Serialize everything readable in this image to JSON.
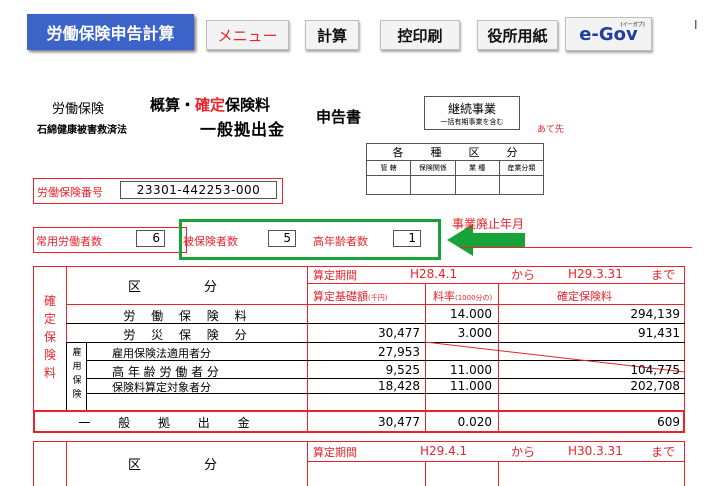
{
  "toolbar": {
    "title": "労働保険申告計算",
    "menu": "メニュー",
    "calc": "計算",
    "print": "控印刷",
    "office_form": "役所用紙",
    "egov_logo": "e-Gov",
    "egov_tag": "(イーガブ)",
    "cursor": "I"
  },
  "header": {
    "line1_a": "労働保険",
    "line1_b": "概算・",
    "line1_c": "確定",
    "line1_d": "保険料",
    "line2_a": "石綿健康被害救済法",
    "line2_b": "一般拠出金",
    "form_title": "申告書",
    "business_box_1": "継続事業",
    "business_box_2": "一括有期事業を含む",
    "addressee": "あて先"
  },
  "category_box": {
    "title_chars": [
      "各",
      "種",
      "区",
      "分"
    ],
    "cols": [
      "管 轄",
      "保険関係",
      "業 種",
      "産業分類"
    ]
  },
  "insurance_no": {
    "label": "労働保険番号",
    "value": "23301-442253-000"
  },
  "counts": {
    "regular_label": "常用労働者数",
    "regular_value": "6",
    "insured_label": "被保険者数",
    "insured_value": "5",
    "elderly_label": "高年齢者数",
    "elderly_value": "1"
  },
  "closure_label": "事業廃止年月",
  "table1": {
    "kubun": "区",
    "bun": "分",
    "period_label": "算定期間",
    "period_from": "H28.4.1",
    "from_word": "から",
    "period_to": "H29.3.31",
    "to_word": "まで",
    "base_label": "算定基礎額",
    "base_unit": "(千円)",
    "rate_label": "料率",
    "rate_unit": "(1000分の)",
    "premium_label": "確定保険料",
    "side_label": [
      "確",
      "定",
      "保",
      "険",
      "料"
    ],
    "employment_side": [
      "雇",
      "用",
      "保",
      "険"
    ],
    "rows": [
      {
        "label": "労 働 保 険 料",
        "base": "",
        "rate": "14.000",
        "premium": "294,139"
      },
      {
        "label": "労 災 保 険 分",
        "base": "30,477",
        "rate": "3.000",
        "premium": "91,431"
      },
      {
        "label": "雇用保険法適用者分",
        "base": "27,953",
        "rate": "",
        "premium": ""
      },
      {
        "label": "高 年 齢 労 働 者 分",
        "base": "9,525",
        "rate": "11.000",
        "premium": "104,775"
      },
      {
        "label": "保険料算定対象者分",
        "base": "18,428",
        "rate": "11.000",
        "premium": "202,708"
      }
    ],
    "general": {
      "label": "一 般 拠 出 金",
      "base": "30,477",
      "rate": "0.020",
      "premium": "609"
    }
  },
  "table2": {
    "kubun": "区",
    "bun": "分",
    "period_label": "算定期間",
    "period_from": "H29.4.1",
    "from_word": "から",
    "period_to": "H30.3.31",
    "to_word": "まで"
  },
  "colors": {
    "accent_red": "#e8232b",
    "highlight_green": "#17a33a",
    "title_blue": "#3b63c8"
  }
}
